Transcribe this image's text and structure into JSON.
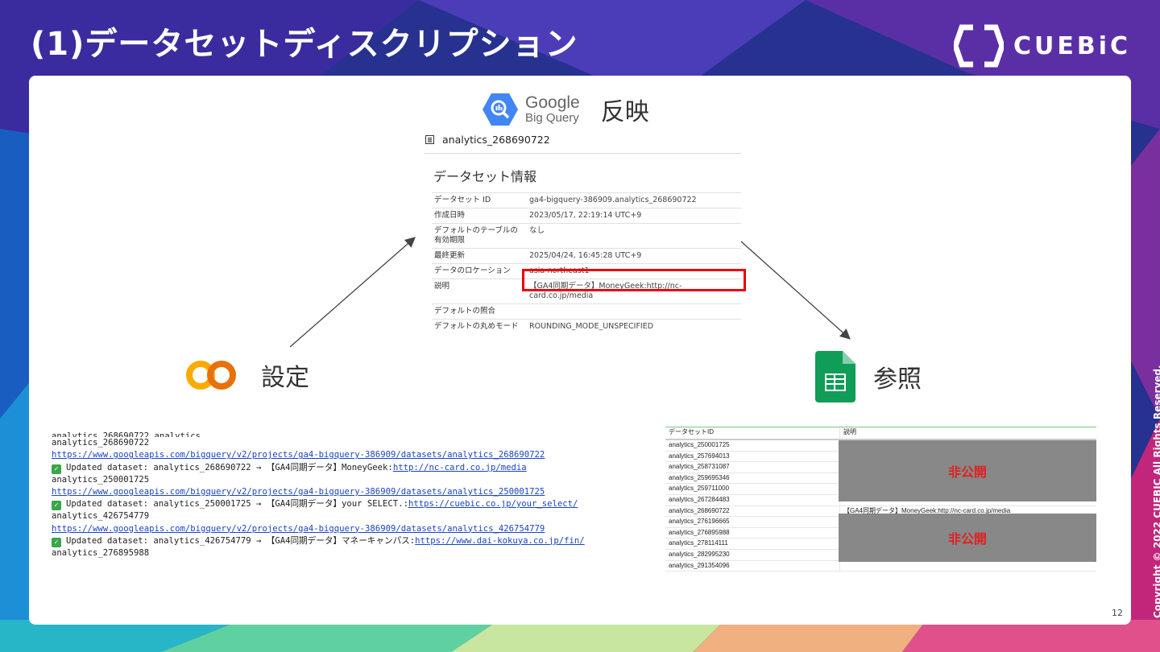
{
  "slide": {
    "title": "(1)データセットディスクリプション",
    "logo": "CUEBiC",
    "copyright": "Copyright © 2022 CUEBIC All Rights Reserved.",
    "page_number": "12"
  },
  "bigquery": {
    "brand_line1": "Google",
    "brand_line2": "Big Query",
    "label": "反映",
    "dataset_name": "analytics_268690722",
    "panel_title": "データセット情報",
    "info_rows": [
      {
        "key": "データセット ID",
        "value": "ga4-bigquery-386909.analytics_268690722"
      },
      {
        "key": "作成日時",
        "value": "2023/05/17, 22:19:14 UTC+9"
      },
      {
        "key": "デフォルトのテーブルの有効期限",
        "value": "なし"
      },
      {
        "key": "最終更新",
        "value": "2025/04/24, 16:45:28 UTC+9"
      },
      {
        "key": "データのロケーション",
        "value": "asia-northeast1"
      },
      {
        "key": "説明",
        "value": "【GA4同期データ】MoneyGeek:http://nc-card.co.jp/media"
      },
      {
        "key": "デフォルトの照合",
        "value": ""
      },
      {
        "key": "デフォルトの丸めモード",
        "value": "ROUNDING_MODE_UNSPECIFIED"
      }
    ]
  },
  "colab": {
    "label": "設定"
  },
  "sheets": {
    "label": "参照"
  },
  "console_log": {
    "lines": [
      {
        "type": "text",
        "text": "analytics_268690722"
      },
      {
        "type": "link",
        "text": "https://www.googleapis.com/bigquery/v2/projects/ga4-bigquery-386909/datasets/analytics_268690722"
      },
      {
        "type": "update",
        "prefix": "Updated dataset: analytics_268690722 → 【GA4同期データ】MoneyGeek:",
        "link": "http://nc-card.co.jp/media"
      },
      {
        "type": "text",
        "text": "analytics_250001725"
      },
      {
        "type": "link",
        "text": "https://www.googleapis.com/bigquery/v2/projects/ga4-bigquery-386909/datasets/analytics_250001725"
      },
      {
        "type": "update",
        "prefix": "Updated dataset: analytics_250001725 → 【GA4同期データ】your SELECT.:",
        "link": "https://cuebic.co.jp/your_select/"
      },
      {
        "type": "text",
        "text": "analytics_426754779"
      },
      {
        "type": "link",
        "text": "https://www.googleapis.com/bigquery/v2/projects/ga4-bigquery-386909/datasets/analytics_426754779"
      },
      {
        "type": "update",
        "prefix": "Updated dataset: analytics_426754779 → 【GA4同期データ】マネーキャンパス:",
        "link": "https://www.dai-kokuya.co.jp/fin/"
      },
      {
        "type": "text",
        "text": "analytics_276895988"
      }
    ]
  },
  "sheet": {
    "headers": [
      "データセットID",
      "説明"
    ],
    "rows": [
      {
        "id": "analytics_250001725",
        "desc": ""
      },
      {
        "id": "analytics_257694013",
        "desc": ""
      },
      {
        "id": "analytics_258731087",
        "desc": ""
      },
      {
        "id": "analytics_259695346",
        "desc": ""
      },
      {
        "id": "analytics_259711000",
        "desc": ""
      },
      {
        "id": "analytics_267284483",
        "desc": ""
      },
      {
        "id": "analytics_268690722",
        "desc": "【GA4同期データ】MoneyGeek:http://nc-card.co.jp/media"
      },
      {
        "id": "analytics_276196665",
        "desc": ""
      },
      {
        "id": "analytics_276895988",
        "desc": ""
      },
      {
        "id": "analytics_278114111",
        "desc": ""
      },
      {
        "id": "analytics_282995230",
        "desc": ""
      },
      {
        "id": "analytics_291354096",
        "desc": ""
      }
    ],
    "redacted_label": "非公開"
  }
}
